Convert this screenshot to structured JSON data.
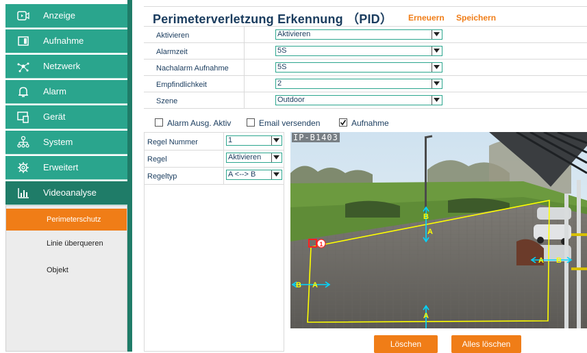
{
  "sidebar": {
    "items": [
      {
        "label": "Anzeige",
        "icon": "display-icon"
      },
      {
        "label": "Aufnahme",
        "icon": "folder-icon"
      },
      {
        "label": "Netzwerk",
        "icon": "network-icon"
      },
      {
        "label": "Alarm",
        "icon": "bell-icon"
      },
      {
        "label": "Gerät",
        "icon": "device-icon"
      },
      {
        "label": "System",
        "icon": "system-icon"
      },
      {
        "label": "Erweitert",
        "icon": "gear-icon"
      },
      {
        "label": "Videoanalyse",
        "icon": "chart-icon"
      }
    ],
    "sub_items": [
      {
        "label": "Perimeterschutz"
      },
      {
        "label": "Linie überqueren"
      },
      {
        "label": "Objekt"
      }
    ],
    "active_item": "Videoanalyse",
    "active_sub_item": "Perimeterschutz"
  },
  "header": {
    "title": "Perimeterverletzung Erkennung （PID）",
    "refresh_label": "Erneuern",
    "save_label": "Speichern"
  },
  "form": {
    "rows": [
      {
        "label": "Aktivieren",
        "value": "Aktivieren"
      },
      {
        "label": "Alarmzeit",
        "value": "5S"
      },
      {
        "label": "Nachalarm Aufnahme",
        "value": "5S"
      },
      {
        "label": "Empfindlichkeit",
        "value": "2"
      },
      {
        "label": "Szene",
        "value": "Outdoor"
      }
    ]
  },
  "checkboxes": [
    {
      "label": "Alarm Ausg. Aktiv",
      "checked": false
    },
    {
      "label": "Email versenden",
      "checked": false
    },
    {
      "label": "Aufnahme",
      "checked": true
    }
  ],
  "rules": [
    {
      "label": "Regel Nummer",
      "value": "1"
    },
    {
      "label": "Regel",
      "value": "Aktivieren"
    },
    {
      "label": "Regeltyp",
      "value": "A <--> B"
    }
  ],
  "video": {
    "osd_text": "IP-B1403",
    "zone_number": "1",
    "direction_labels": {
      "side_a": "A",
      "side_b": "B"
    }
  },
  "buttons": {
    "delete_label": "Löschen",
    "delete_all_label": "Alles löschen"
  },
  "colors": {
    "accent": "#2aa58d",
    "accent_dark": "#1f7c68",
    "orange": "#f07d17",
    "title": "#1a3c5e",
    "zone_line": "#ffff00",
    "arrow": "#00d8ff"
  }
}
